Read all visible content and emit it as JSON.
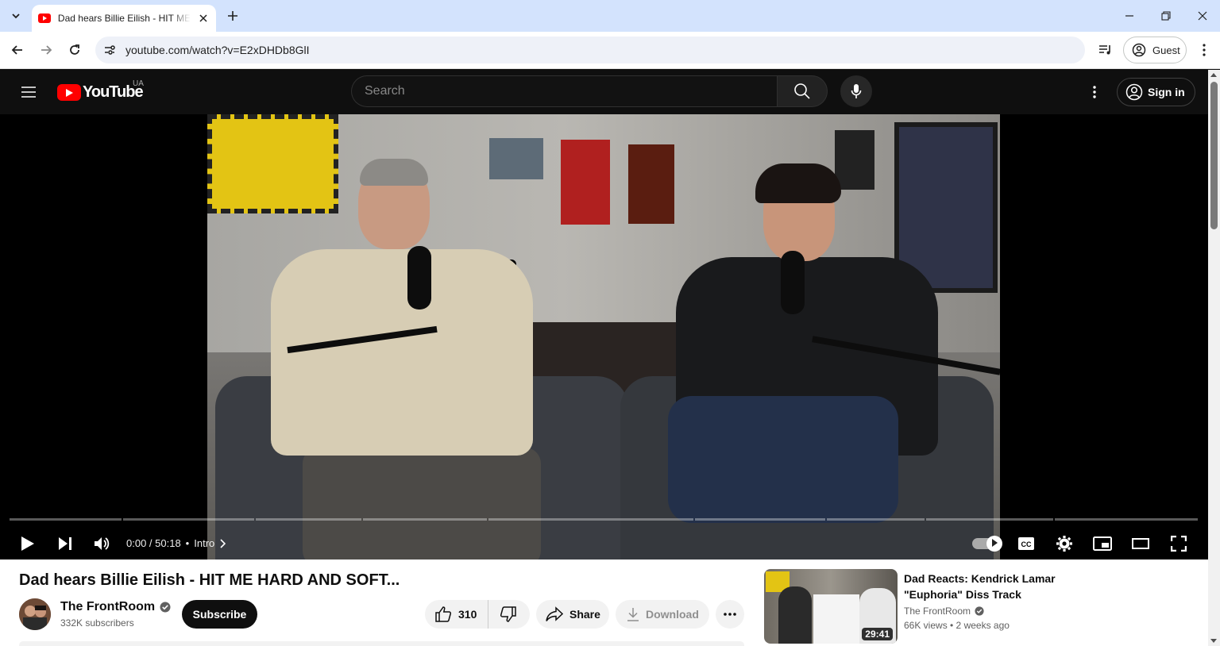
{
  "browser": {
    "tab_title": "Dad hears Billie Eilish - HIT ME HARD AND SOFT",
    "url": "youtube.com/watch?v=E2xDHDb8GlI",
    "profile_label": "Guest"
  },
  "masthead": {
    "logo_text": "YouTube",
    "country_code": "UA",
    "search_placeholder": "Search",
    "signin_label": "Sign in"
  },
  "player": {
    "time": "0:00 / 50:18",
    "separator": "•",
    "chapter": "Intro",
    "progress_fraction": 0.0
  },
  "video": {
    "title": "Dad hears Billie Eilish - HIT ME HARD AND SOFT...",
    "channel": "The FrontRoom",
    "subscribers": "332K subscribers",
    "subscribe_label": "Subscribe",
    "likes": "310",
    "share_label": "Share",
    "download_label": "Download"
  },
  "recommendation": {
    "title": "Dad Reacts: Kendrick Lamar \"Euphoria\" Diss Track",
    "channel": "The FrontRoom",
    "meta": "66K views • 2 weeks ago",
    "duration": "29:41"
  },
  "colors": {
    "brand_red": "#ff0000",
    "page_dark": "#0f0f0f",
    "chrome_tabstrip": "#d3e3fd"
  }
}
